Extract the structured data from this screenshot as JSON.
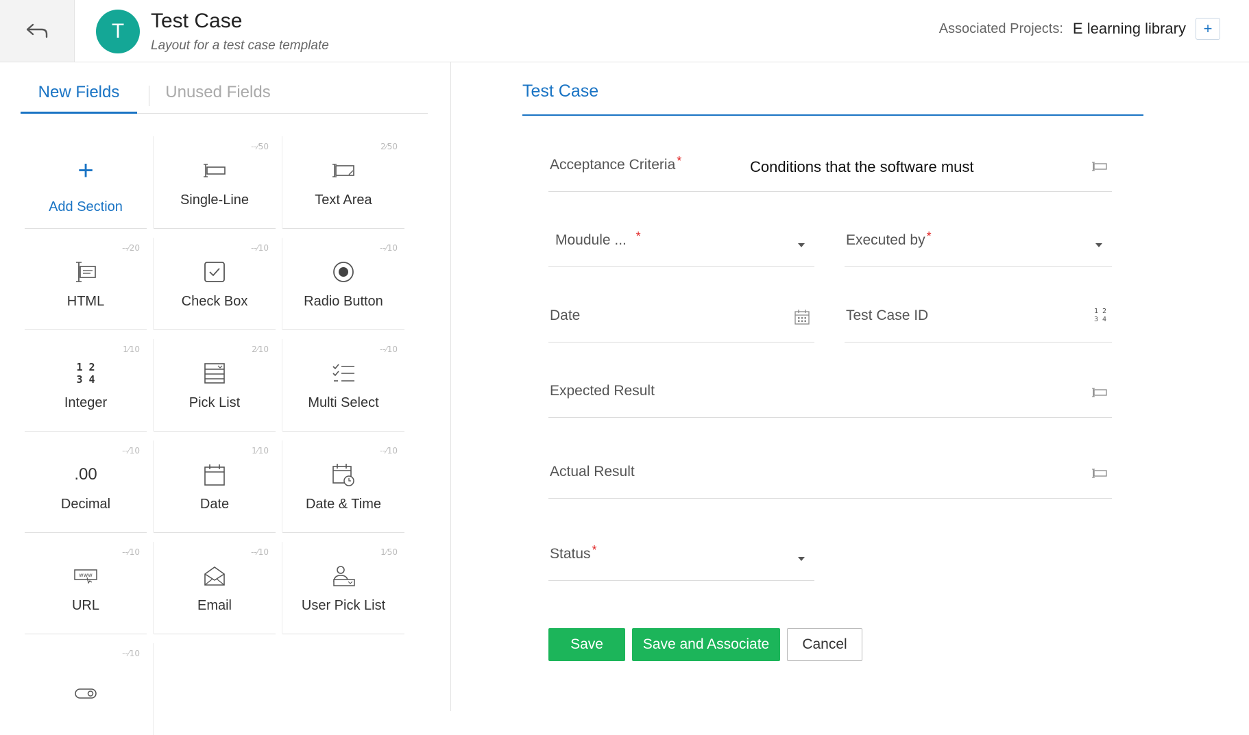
{
  "header": {
    "avatar_letter": "T",
    "title": "Test Case",
    "subtitle": "Layout for a test case template",
    "associated_label": "Associated Projects:",
    "associated_value": "E learning library",
    "add_label": "+"
  },
  "left": {
    "tabs": {
      "new": "New Fields",
      "unused": "Unused Fields"
    },
    "add_section": {
      "plus": "+",
      "label": "Add Section"
    },
    "fields": [
      {
        "label": "Single-Line",
        "count": "--⁄50",
        "icon": "single-line-icon"
      },
      {
        "label": "Text Area",
        "count": "2⁄50",
        "icon": "text-area-icon"
      },
      {
        "label": "HTML",
        "count": "--⁄20",
        "icon": "html-icon"
      },
      {
        "label": "Check Box",
        "count": "--⁄10",
        "icon": "checkbox-icon"
      },
      {
        "label": "Radio Button",
        "count": "--⁄10",
        "icon": "radio-icon"
      },
      {
        "label": "Integer",
        "count": "1⁄10",
        "icon": "integer-icon"
      },
      {
        "label": "Pick List",
        "count": "2⁄10",
        "icon": "picklist-icon"
      },
      {
        "label": "Multi Select",
        "count": "--⁄10",
        "icon": "multi-select-icon"
      },
      {
        "label": "Decimal",
        "count": "--⁄10",
        "icon": "decimal-icon"
      },
      {
        "label": "Date",
        "count": "1⁄10",
        "icon": "calendar-icon"
      },
      {
        "label": "Date & Time",
        "count": "--⁄10",
        "icon": "datetime-icon"
      },
      {
        "label": "URL",
        "count": "--⁄10",
        "icon": "url-icon"
      },
      {
        "label": "Email",
        "count": "--⁄10",
        "icon": "email-icon"
      },
      {
        "label": "User Pick List",
        "count": "1⁄50",
        "icon": "user-picklist-icon"
      },
      {
        "label": "",
        "count": "--⁄10",
        "icon": "toggle-icon"
      }
    ],
    "integer_glyph": [
      "1 2",
      "3 4"
    ],
    "decimal_glyph": ".00"
  },
  "form": {
    "title": "Test Case",
    "fields": {
      "acceptance": {
        "label": "Acceptance Criteria",
        "value": "Conditions that the software must"
      },
      "module": {
        "label": "Moudule ..."
      },
      "executed_by": {
        "label": "Executed by"
      },
      "date": {
        "label": "Date"
      },
      "test_case_id": {
        "label": "Test Case ID",
        "glyph_top": "1 2",
        "glyph_bottom": "3 4"
      },
      "expected": {
        "label": "Expected Result"
      },
      "actual": {
        "label": "Actual Result"
      },
      "status": {
        "label": "Status"
      }
    },
    "required_mark": "*",
    "buttons": {
      "save": "Save",
      "save_associate": "Save and Associate",
      "cancel": "Cancel"
    }
  },
  "colors": {
    "accent": "#1a74c4",
    "avatar": "#14a796",
    "save": "#1cb55a",
    "required": "#e02020"
  }
}
